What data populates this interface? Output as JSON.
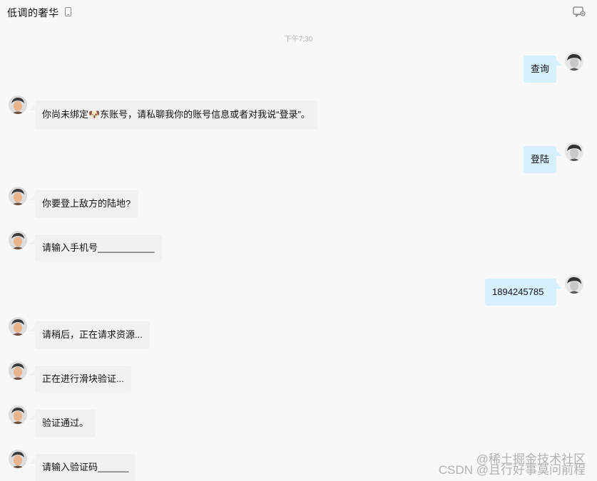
{
  "header": {
    "title": "低调的奢华",
    "phone_icon": "phone-icon",
    "menu_icon": "chat-menu-icon"
  },
  "timestamp": "下午7:30",
  "messages": [
    {
      "side": "user",
      "text": "查询"
    },
    {
      "side": "bot",
      "text": "你尚未绑定🐶东账号，请私聊我你的账号信息或者对我说“登录”。"
    },
    {
      "side": "user",
      "text": "登陆"
    },
    {
      "side": "bot",
      "text": "你要登上敌方的陆地?"
    },
    {
      "side": "bot",
      "text": "请输入手机号___________"
    },
    {
      "side": "user",
      "text": "1894245785"
    },
    {
      "side": "bot",
      "text": "请稍后，正在请求资源..."
    },
    {
      "side": "bot",
      "text": "正在进行滑块验证..."
    },
    {
      "side": "bot",
      "text": "验证通过。"
    },
    {
      "side": "bot",
      "text": "请输入验证码______"
    }
  ],
  "watermark": {
    "line1": "@稀土掘金技术社区",
    "line2": "CSDN @且行好事莫问前程"
  },
  "colors": {
    "background": "#f8f8f8",
    "bot_bubble": "#f1f1f1",
    "user_bubble": "#d6f0ff"
  }
}
